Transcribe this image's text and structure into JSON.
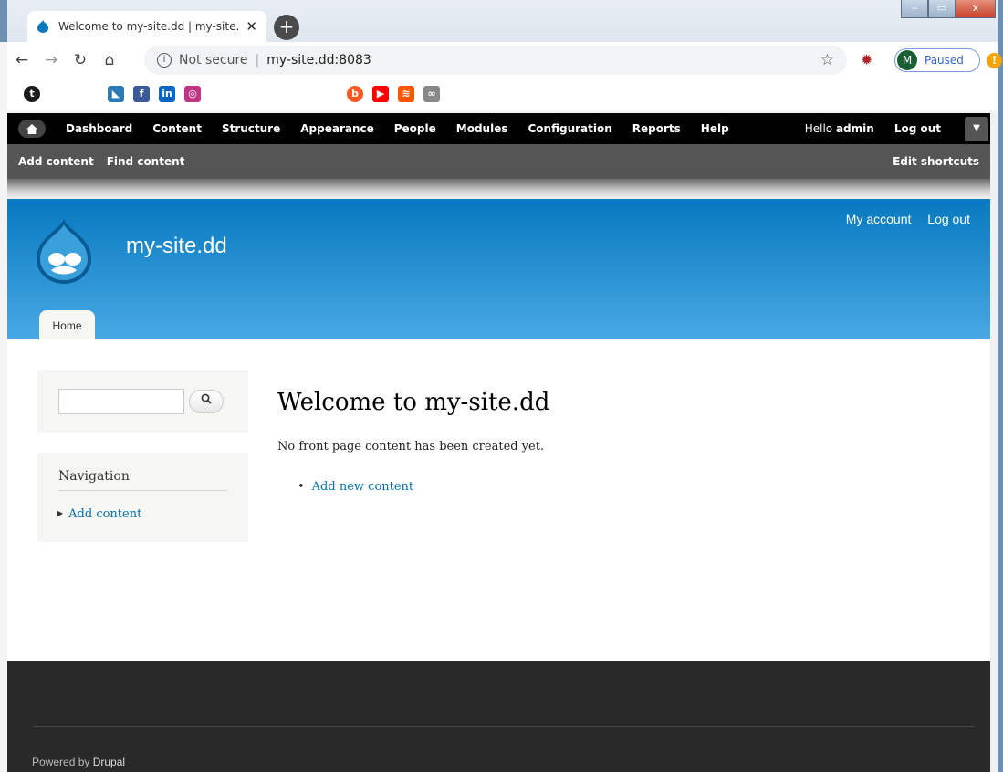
{
  "browser": {
    "tab_title": "Welcome to my-site.dd | my-site.",
    "tab_close": "✕",
    "new_tab": "+",
    "security_label": "Not secure",
    "url": "my-site.dd:8083",
    "profile_initial": "M",
    "profile_status": "Paused",
    "bookmarks": [
      {
        "icon": "tumblr-icon",
        "text": "t",
        "color": "#1b1b1b"
      },
      {
        "icon": "flag-icon",
        "text": "◣",
        "color": "#2a7ab8"
      },
      {
        "icon": "facebook-icon",
        "text": "f",
        "color": "#3b5998"
      },
      {
        "icon": "linkedin-icon",
        "text": "in",
        "color": "#0a66c2"
      },
      {
        "icon": "instagram-icon",
        "text": "◎",
        "color": "#c13584"
      },
      {
        "icon": "blogger-icon",
        "text": "b",
        "color": "#ff5722"
      },
      {
        "icon": "youtube-icon",
        "text": "▶",
        "color": "#ff0000"
      },
      {
        "icon": "soundcloud-icon",
        "text": "≋",
        "color": "#ff5500"
      },
      {
        "icon": "link-icon",
        "text": "∞",
        "color": "#888888"
      }
    ]
  },
  "admin_toolbar": {
    "items": [
      "Dashboard",
      "Content",
      "Structure",
      "Appearance",
      "People",
      "Modules",
      "Configuration",
      "Reports",
      "Help"
    ],
    "hello": "Hello ",
    "user": "admin",
    "logout": "Log out",
    "shortcuts": [
      "Add content",
      "Find content"
    ],
    "edit_shortcuts": "Edit shortcuts"
  },
  "site": {
    "name": "my-site.dd",
    "secondary_menu": [
      "My account",
      "Log out"
    ],
    "primary_tab": "Home"
  },
  "sidebar": {
    "search_value": "",
    "nav_title": "Navigation",
    "nav_link": "Add content"
  },
  "main": {
    "title": "Welcome to my-site.dd",
    "text": "No front page content has been created yet.",
    "link": "Add new content"
  },
  "footer": {
    "powered_by": "Powered by ",
    "drupal": "Drupal"
  },
  "colors": {
    "header_top": "#0779bf",
    "header_bottom": "#48a9e4",
    "link": "#0071b3",
    "footer": "#292929"
  }
}
